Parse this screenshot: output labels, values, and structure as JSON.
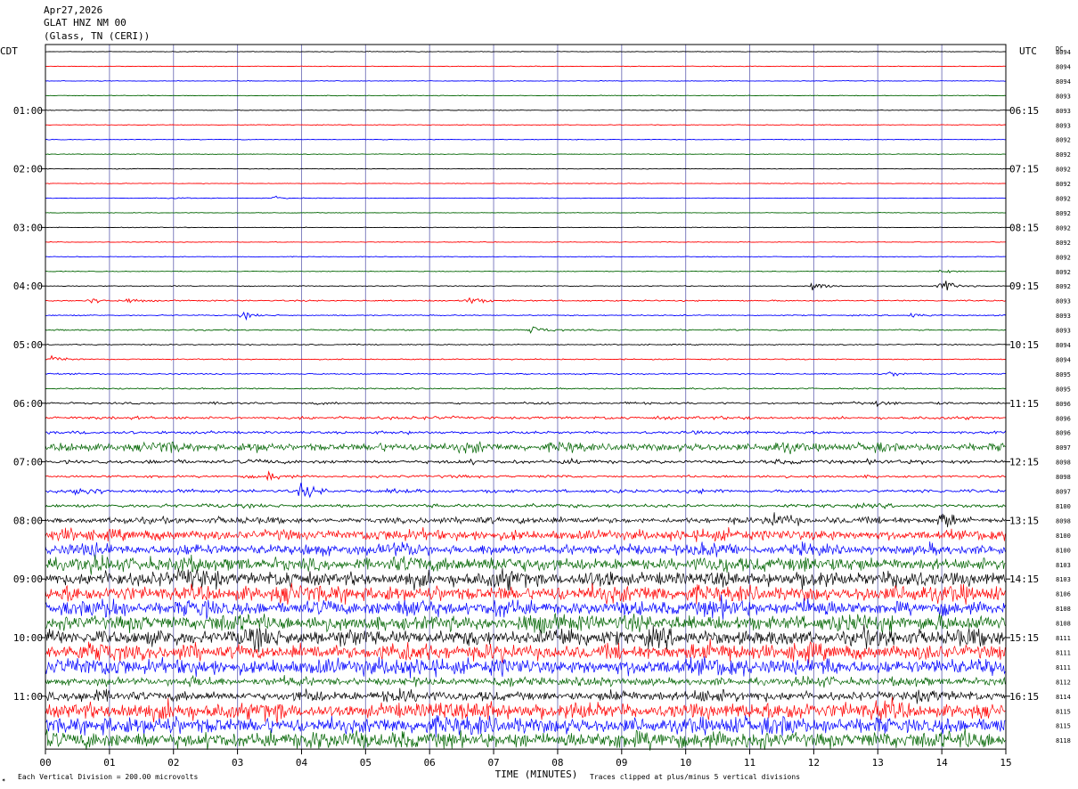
{
  "header": {
    "date": "Apr27,2026",
    "station": "GLAT HNZ NM 00",
    "location": "(Glass, TN (CERI))"
  },
  "axes": {
    "left_timezone": "CDT",
    "right_timezone": "UTC",
    "dc_label": "DC",
    "x_title": "TIME (MINUTES)"
  },
  "footer": {
    "scale_note": "Each Vertical Division =  200.00 microvolts",
    "clip_note": "Traces clipped at plus/minus 5 vertical divisions",
    "corner_mark": "✶"
  },
  "chart_data": {
    "type": "line",
    "subtype": "helicorder",
    "x_ticks": [
      "00",
      "01",
      "02",
      "03",
      "04",
      "05",
      "06",
      "07",
      "08",
      "09",
      "10",
      "11",
      "12",
      "13",
      "14",
      "15"
    ],
    "xlim": [
      0,
      15
    ],
    "minutes_per_line": 15,
    "left_hour_labels": [
      {
        "line": 4,
        "label": "01:00"
      },
      {
        "line": 8,
        "label": "02:00"
      },
      {
        "line": 12,
        "label": "03:00"
      },
      {
        "line": 16,
        "label": "04:00"
      },
      {
        "line": 20,
        "label": "05:00"
      },
      {
        "line": 24,
        "label": "06:00"
      },
      {
        "line": 28,
        "label": "07:00"
      },
      {
        "line": 32,
        "label": "08:00"
      },
      {
        "line": 36,
        "label": "09:00"
      },
      {
        "line": 40,
        "label": "10:00"
      },
      {
        "line": 44,
        "label": "11:00"
      }
    ],
    "right_hour_labels": [
      {
        "line": 4,
        "label": "06:15"
      },
      {
        "line": 8,
        "label": "07:15"
      },
      {
        "line": 12,
        "label": "08:15"
      },
      {
        "line": 16,
        "label": "09:15"
      },
      {
        "line": 20,
        "label": "10:15"
      },
      {
        "line": 24,
        "label": "11:15"
      },
      {
        "line": 28,
        "label": "12:15"
      },
      {
        "line": 32,
        "label": "13:15"
      },
      {
        "line": 36,
        "label": "14:15"
      },
      {
        "line": 40,
        "label": "15:15"
      },
      {
        "line": 44,
        "label": "16:15"
      }
    ],
    "dc_offsets": [
      "8094",
      "8094",
      "8094",
      "8093",
      "8093",
      "8093",
      "8092",
      "8092",
      "8092",
      "8092",
      "8092",
      "8092",
      "8092",
      "8092",
      "8092",
      "8092",
      "8092",
      "8093",
      "8093",
      "8093",
      "8094",
      "8094",
      "8095",
      "8095",
      "8096",
      "8096",
      "8096",
      "8097",
      "8098",
      "8098",
      "8097",
      "8100",
      "8098",
      "8100",
      "8100",
      "8103",
      "8103",
      "8106",
      "8108",
      "8108",
      "8111",
      "8111",
      "8111",
      "8112",
      "8114",
      "8115",
      "8115",
      "8118"
    ],
    "trace_colors": [
      "#000000",
      "#ff0000",
      "#0000ff",
      "#006400"
    ],
    "grid_color": "#8080c0",
    "line_amplitude": [
      0.3,
      0.3,
      0.3,
      0.3,
      0.3,
      0.3,
      0.3,
      0.3,
      0.3,
      0.3,
      0.3,
      0.3,
      0.3,
      0.3,
      0.3,
      0.3,
      0.4,
      0.6,
      0.5,
      0.6,
      0.5,
      0.5,
      0.6,
      0.6,
      1.2,
      1.6,
      1.6,
      5,
      2.2,
      1.4,
      2,
      2,
      3.5,
      6,
      6.5,
      8,
      9,
      9,
      9,
      9,
      9.5,
      9.5,
      9.5,
      5,
      6,
      9.5,
      9.5,
      9.5
    ],
    "events": [
      {
        "line": 10,
        "minute": 2.0,
        "amp": 0.6
      },
      {
        "line": 10,
        "minute": 3.6,
        "amp": 1.6
      },
      {
        "line": 15,
        "minute": 14.0,
        "amp": 2
      },
      {
        "line": 16,
        "minute": 12.0,
        "amp": 5
      },
      {
        "line": 16,
        "minute": 14.0,
        "amp": 8
      },
      {
        "line": 17,
        "minute": 0.7,
        "amp": 3
      },
      {
        "line": 17,
        "minute": 1.3,
        "amp": 2
      },
      {
        "line": 17,
        "minute": 6.6,
        "amp": 5
      },
      {
        "line": 18,
        "minute": 3.1,
        "amp": 3
      },
      {
        "line": 18,
        "minute": 13.5,
        "amp": 2.5
      },
      {
        "line": 19,
        "minute": 7.6,
        "amp": 4
      },
      {
        "line": 21,
        "minute": 0.1,
        "amp": 3
      },
      {
        "line": 22,
        "minute": 13.2,
        "amp": 2
      },
      {
        "line": 24,
        "minute": 13.0,
        "amp": 2.5
      },
      {
        "line": 29,
        "minute": 3.5,
        "amp": 5
      },
      {
        "line": 30,
        "minute": 0.5,
        "amp": 5
      },
      {
        "line": 30,
        "minute": 4.0,
        "amp": 6
      },
      {
        "line": 32,
        "minute": 14.0,
        "amp": 10
      },
      {
        "line": 32,
        "minute": 11.3,
        "amp": 8
      }
    ]
  }
}
